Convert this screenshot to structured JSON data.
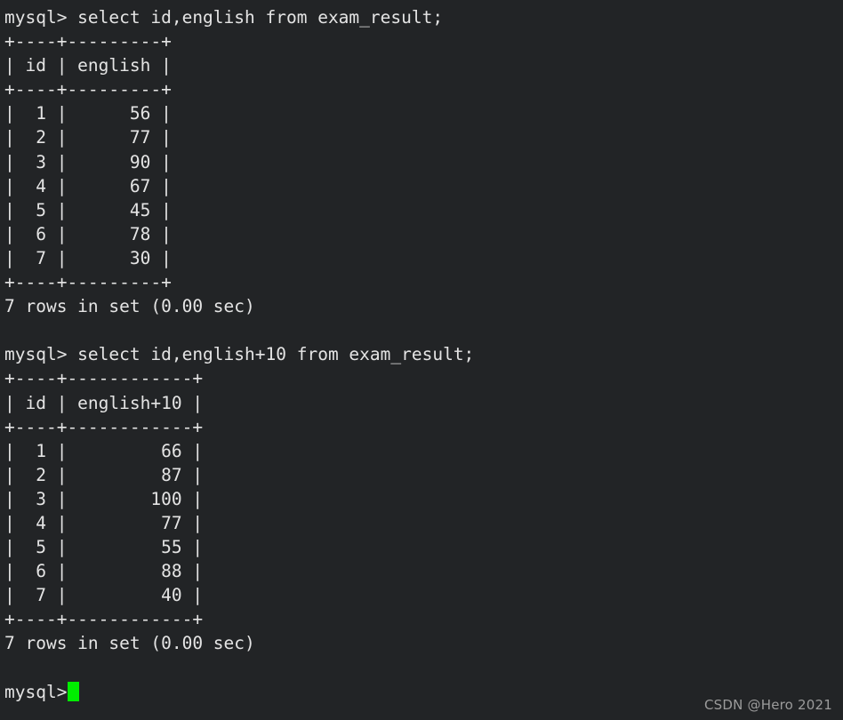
{
  "terminal": {
    "background_color": "#222426",
    "text_color": "#e4e4e4",
    "cursor_color": "#00ee00",
    "prompt": "mysql> ",
    "blocks": [
      {
        "command": "mysql> select id,english from exam_result;",
        "table": {
          "top_border": "+----+---------+",
          "header_row": "| id | english |",
          "header_sep": "+----+---------+",
          "rows": [
            "|  1 |      56 |",
            "|  2 |      77 |",
            "|  3 |      90 |",
            "|  4 |      67 |",
            "|  5 |      45 |",
            "|  6 |      78 |",
            "|  7 |      30 |"
          ],
          "bottom_border": "+----+---------+"
        },
        "status": "7 rows in set (0.00 sec)"
      },
      {
        "command": "mysql> select id,english+10 from exam_result;",
        "table": {
          "top_border": "+----+------------+",
          "header_row": "| id | english+10 |",
          "header_sep": "+----+------------+",
          "rows": [
            "|  1 |         66 |",
            "|  2 |         87 |",
            "|  3 |        100 |",
            "|  4 |         77 |",
            "|  5 |         55 |",
            "|  6 |         88 |",
            "|  7 |         40 |"
          ],
          "bottom_border": "+----+------------+"
        },
        "status": "7 rows in set (0.00 sec)"
      }
    ],
    "final_prompt": "mysql>"
  },
  "watermark": {
    "text": "CSDN @Hero 2021"
  },
  "query_results": {
    "table_name": "exam_result",
    "columns": [
      "id",
      "english",
      "english+10"
    ],
    "rows": [
      {
        "id": 1,
        "english": 56,
        "english+10": 66
      },
      {
        "id": 2,
        "english": 77,
        "english+10": 87
      },
      {
        "id": 3,
        "english": 90,
        "english+10": 100
      },
      {
        "id": 4,
        "english": 67,
        "english+10": 77
      },
      {
        "id": 5,
        "english": 45,
        "english+10": 55
      },
      {
        "id": 6,
        "english": 78,
        "english+10": 88
      },
      {
        "id": 7,
        "english": 30,
        "english+10": 40
      }
    ],
    "row_count": 7,
    "elapsed": "0.00 sec"
  }
}
